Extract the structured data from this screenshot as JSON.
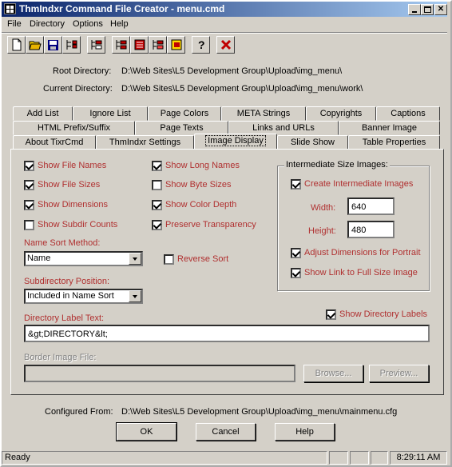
{
  "window": {
    "title": "ThmIndxr Command File Creator - menu.cmd"
  },
  "menu": {
    "file": "File",
    "directory": "Directory",
    "options": "Options",
    "help": "Help"
  },
  "header": {
    "root_label": "Root Directory:",
    "root_value": "D:\\Web Sites\\L5 Development Group\\Upload\\img_menu\\",
    "current_label": "Current Directory:",
    "current_value": "D:\\Web Sites\\L5 Development Group\\Upload\\img_menu\\work\\"
  },
  "tabs": {
    "row1": [
      "Add List",
      "Ignore List",
      "Page Colors",
      "META Strings",
      "Copyrights",
      "Captions"
    ],
    "row2": [
      "HTML Prefix/Suffix",
      "Page Texts",
      "Links and URLs",
      "Banner Image"
    ],
    "row3": [
      "About TixrCmd",
      "ThmIndxr Settings",
      "Image Display",
      "Slide Show",
      "Table Properties"
    ]
  },
  "options": {
    "show_file_names": "Show File Names",
    "show_file_sizes": "Show File Sizes",
    "show_dimensions": "Show Dimensions",
    "show_subdir_counts": "Show Subdir Counts",
    "show_long_names": "Show Long Names",
    "show_byte_sizes": "Show Byte Sizes",
    "show_color_depth": "Show Color Depth",
    "preserve_transparency": "Preserve Transparency",
    "reverse_sort": "Reverse Sort",
    "show_directory_labels": "Show Directory Labels"
  },
  "name_sort": {
    "label": "Name Sort Method:",
    "value": "Name"
  },
  "subdir_position": {
    "label": "Subdirectory Position:",
    "value": "Included in Name Sort"
  },
  "intermediate": {
    "title": "Intermediate Size Images:",
    "create": "Create Intermediate Images",
    "width_label": "Width:",
    "width_value": "640",
    "height_label": "Height:",
    "height_value": "480",
    "adjust_portrait": "Adjust Dimensions for Portrait",
    "show_link": "Show Link to Full Size Image"
  },
  "dir_label": {
    "label": "Directory Label Text:",
    "value": "&gt;DIRECTORY&lt;"
  },
  "border_image": {
    "label": "Border Image File:",
    "value": "",
    "browse": "Browse...",
    "preview": "Preview..."
  },
  "footer": {
    "configured_label": "Configured From:",
    "configured_value": "D:\\Web Sites\\L5 Development Group\\Upload\\img_menu\\mainmenu.cfg",
    "ok": "OK",
    "cancel": "Cancel",
    "help": "Help"
  },
  "status": {
    "text": "Ready",
    "time": "8:29:11 AM"
  },
  "toolbar_icons": [
    "new-icon",
    "open-icon",
    "save-icon",
    "tree-icon",
    "list-icon",
    "list-add-icon",
    "list-remove-icon",
    "list-edit-icon",
    "list-image-icon",
    "help-icon",
    "close-icon"
  ]
}
